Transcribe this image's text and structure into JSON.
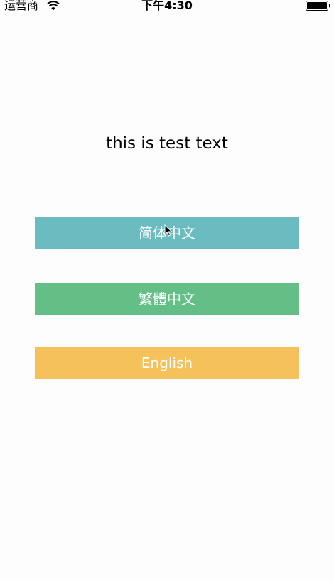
{
  "status_bar": {
    "carrier": "运营商",
    "time": "下午4:30",
    "wifi_icon": "wifi-icon",
    "battery_icon": "battery-icon"
  },
  "main": {
    "label": "this is test text",
    "buttons": [
      {
        "label": "简体中文",
        "color": "#6abcc1"
      },
      {
        "label": "繁體中文",
        "color": "#64bf87"
      },
      {
        "label": "English",
        "color": "#f5c15a"
      }
    ]
  },
  "cursor_icon": "mouse-pointer-icon"
}
